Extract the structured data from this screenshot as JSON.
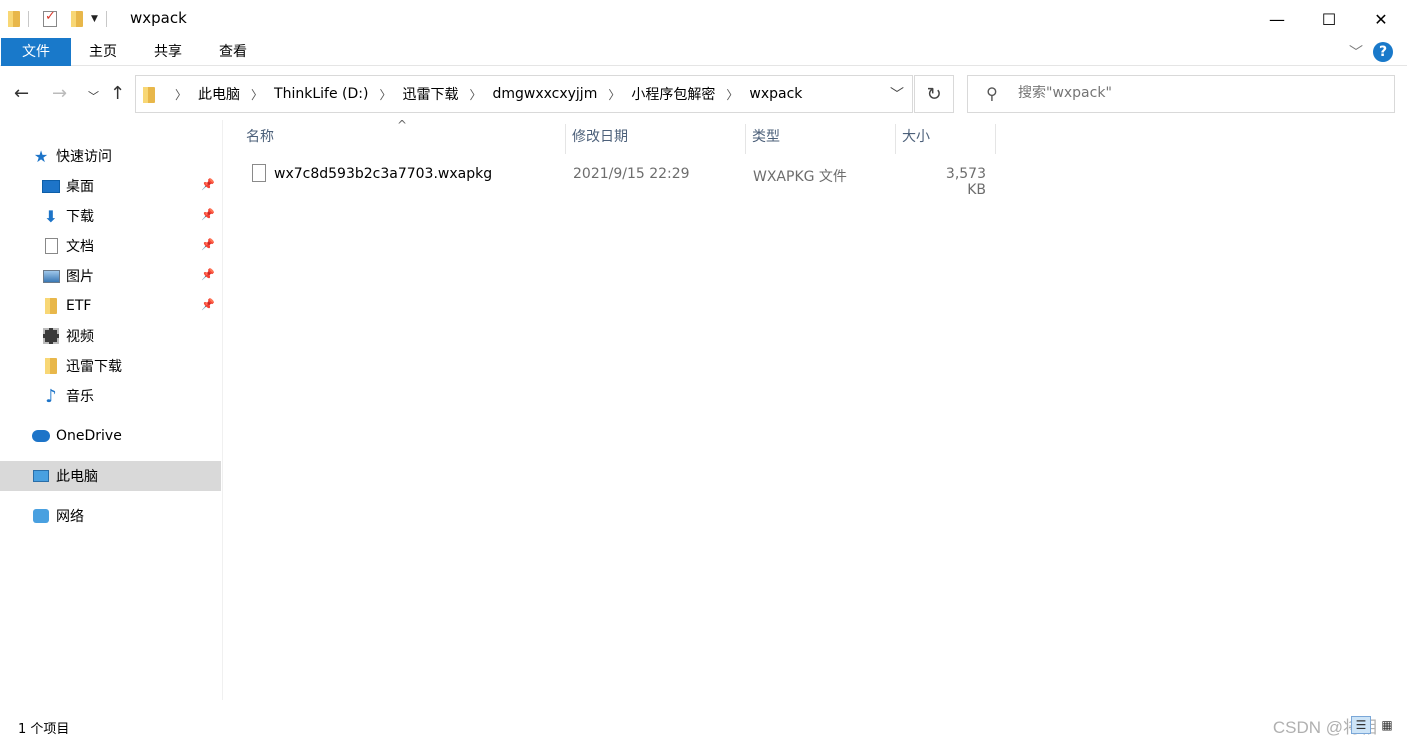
{
  "window": {
    "title": "wxpack",
    "controls": {
      "minimize": "—",
      "maximize": "☐",
      "close": "✕"
    }
  },
  "ribbon": {
    "tabs": [
      "文件",
      "主页",
      "共享",
      "查看"
    ]
  },
  "nav": {
    "breadcrumbs": [
      "此电脑",
      "ThinkLife (D:)",
      "迅雷下载",
      "dmgwxxcxyjjm",
      "小程序包解密",
      "wxpack"
    ],
    "search_placeholder": "搜索\"wxpack\""
  },
  "sidebar": {
    "quick_access": "快速访问",
    "pinned": [
      {
        "label": "桌面",
        "icon": "desktop-icon",
        "pinned": true
      },
      {
        "label": "下载",
        "icon": "download-icon",
        "pinned": true
      },
      {
        "label": "文档",
        "icon": "document-icon",
        "pinned": true
      },
      {
        "label": "图片",
        "icon": "pictures-icon",
        "pinned": true
      },
      {
        "label": "ETF",
        "icon": "folder-icon",
        "pinned": true
      },
      {
        "label": "视频",
        "icon": "video-icon",
        "pinned": false
      },
      {
        "label": "迅雷下载",
        "icon": "folder-icon",
        "pinned": false
      },
      {
        "label": "音乐",
        "icon": "music-icon",
        "pinned": false
      }
    ],
    "onedrive": "OneDrive",
    "this_pc": "此电脑",
    "network": "网络"
  },
  "filelist": {
    "columns": {
      "name": "名称",
      "date": "修改日期",
      "type": "类型",
      "size": "大小"
    },
    "files": [
      {
        "name": "wx7c8d593b2c3a7703.wxapkg",
        "date": "2021/9/15 22:29",
        "type": "WXAPKG 文件",
        "size": "3,573 KB"
      }
    ]
  },
  "status": {
    "item_count": "1 个项目",
    "watermark": "CSDN @将相"
  },
  "colors": {
    "accent": "#1979ca",
    "selected_bg": "#d9d9d9",
    "column_header_text": "#4c607a"
  }
}
